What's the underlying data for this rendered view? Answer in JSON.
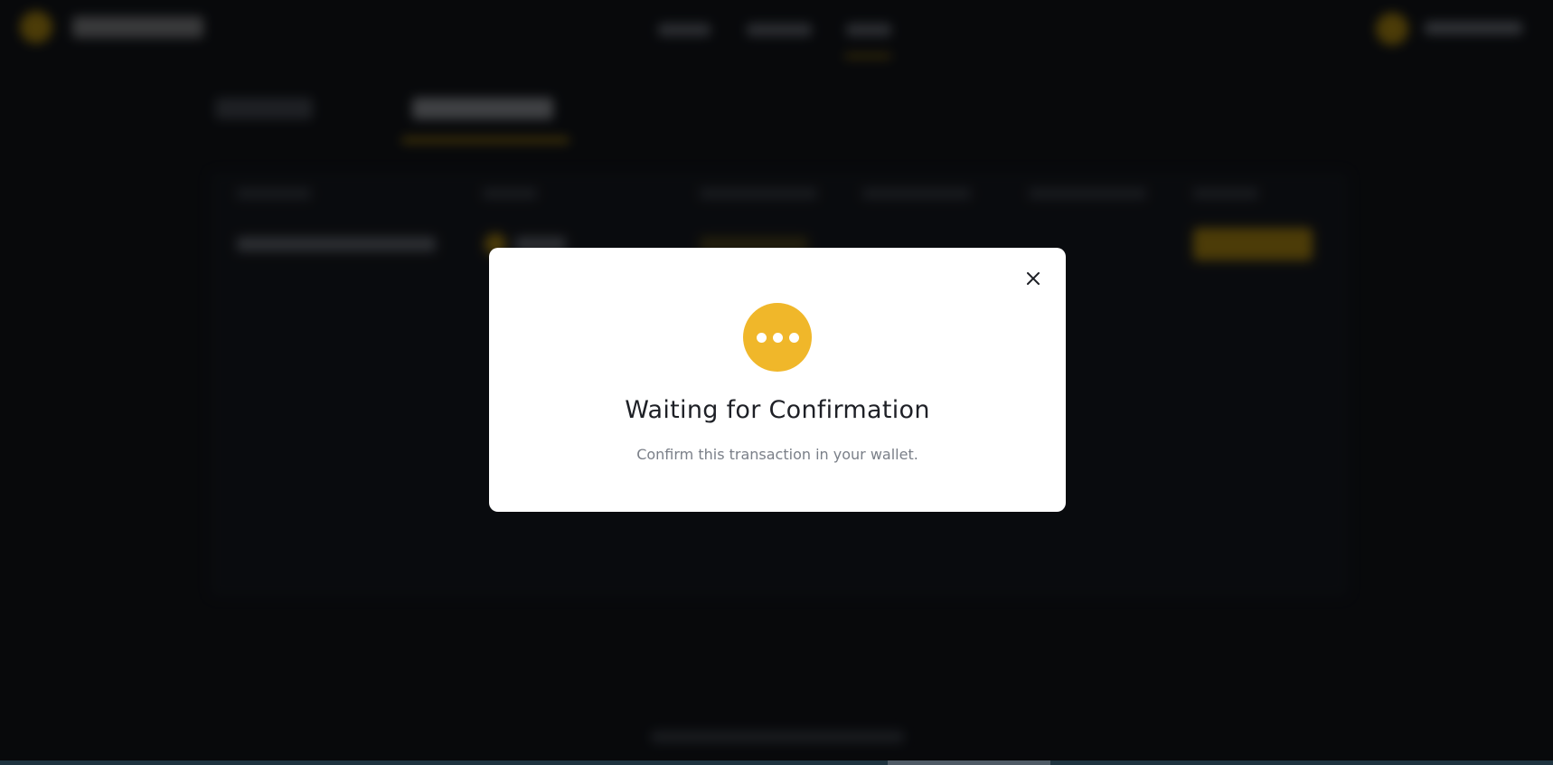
{
  "modal": {
    "title": "Waiting for Confirmation",
    "subtitle": "Confirm this transaction in your wallet.",
    "status_icon": "pending-dots-icon",
    "close_icon": "close-icon"
  },
  "colors": {
    "accent": "#f0b72a",
    "background": "#0f1115",
    "modal_bg": "#ffffff",
    "title_text": "#1e2026",
    "subtitle_text": "#7a7f88"
  }
}
